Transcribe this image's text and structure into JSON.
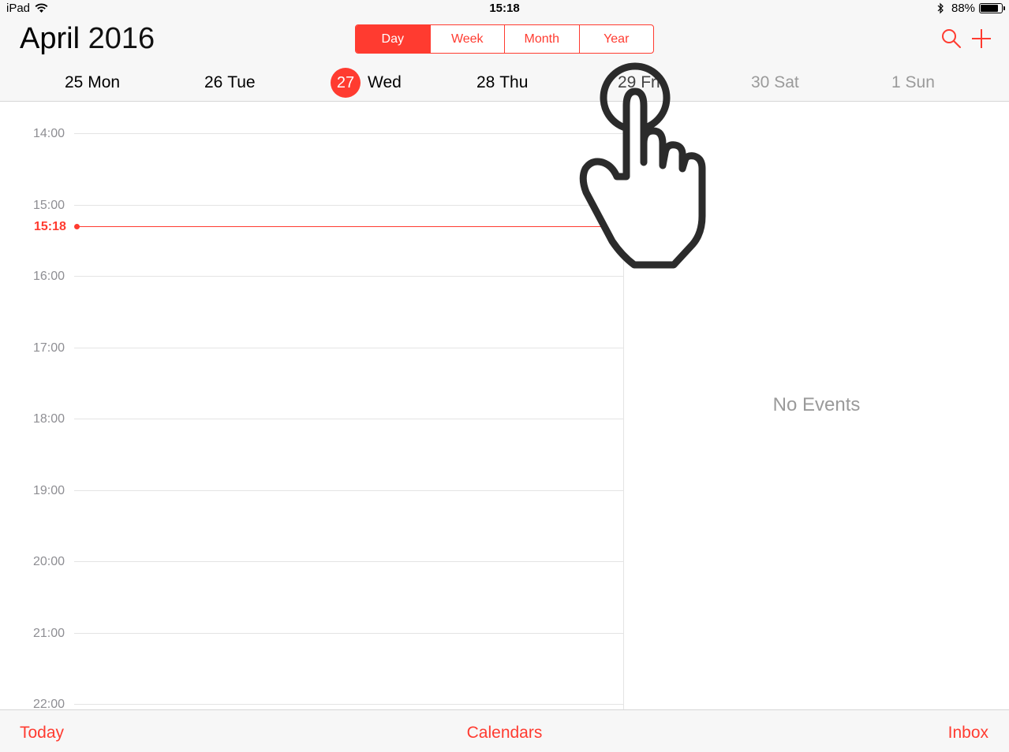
{
  "status_bar": {
    "carrier": "iPad",
    "time": "15:18",
    "battery": "88%",
    "battery_level": 0.88,
    "icons": [
      "wifi-icon",
      "bluetooth-icon",
      "battery-icon"
    ]
  },
  "header": {
    "month": "April",
    "year": "2016",
    "view_modes": [
      "Day",
      "Week",
      "Month",
      "Year"
    ],
    "active_view": "Day",
    "actions": [
      "search-icon",
      "add-icon"
    ]
  },
  "week": {
    "days": [
      {
        "num": "25",
        "name": "Mon"
      },
      {
        "num": "26",
        "name": "Tue"
      },
      {
        "num": "27",
        "name": "Wed"
      },
      {
        "num": "28",
        "name": "Thu"
      },
      {
        "num": "29",
        "name": "Fri"
      },
      {
        "num": "30",
        "name": "Sat"
      },
      {
        "num": "1",
        "name": "Sun"
      }
    ],
    "today_index": 2
  },
  "timeline": {
    "hours": [
      "14:00",
      "15:00",
      "16:00",
      "17:00",
      "18:00",
      "19:00",
      "20:00",
      "21:00",
      "22:00"
    ],
    "now": "15:18"
  },
  "events_panel": {
    "empty_text": "No Events"
  },
  "toolbar": {
    "today": "Today",
    "calendars": "Calendars",
    "inbox": "Inbox"
  },
  "overlay": {
    "icon": "hand-pointer-icon"
  },
  "colors": {
    "accent": "#ff3b30",
    "secondary_text": "#8e8e93",
    "bar_background": "#f7f7f7"
  }
}
